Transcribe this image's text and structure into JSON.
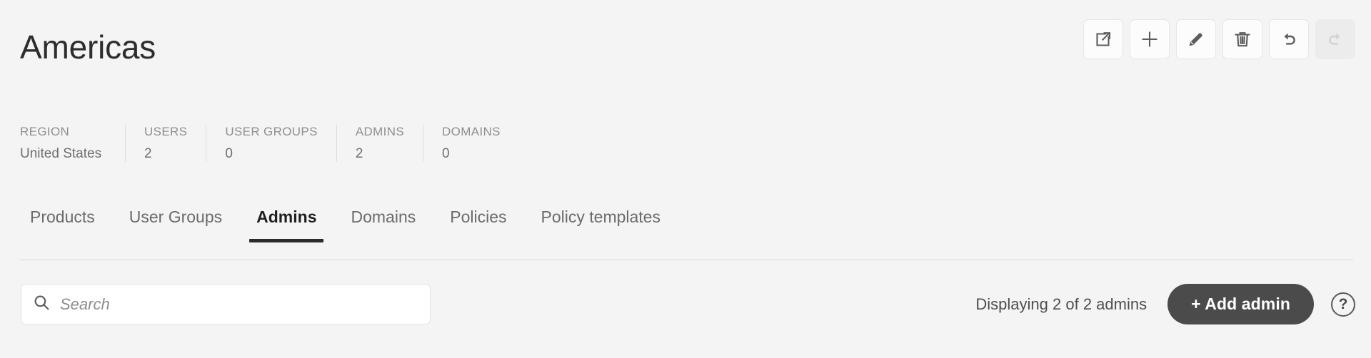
{
  "header": {
    "title": "Americas",
    "toolbar": [
      {
        "name": "export-icon",
        "label": "Export",
        "disabled": false
      },
      {
        "name": "add-icon",
        "label": "Add",
        "disabled": false
      },
      {
        "name": "edit-pencil-icon",
        "label": "Edit",
        "disabled": false
      },
      {
        "name": "delete-trash-icon",
        "label": "Delete",
        "disabled": false
      },
      {
        "name": "undo-icon",
        "label": "Undo",
        "disabled": false
      },
      {
        "name": "redo-icon",
        "label": "Redo",
        "disabled": true
      }
    ]
  },
  "stats": [
    {
      "label": "REGION",
      "value": "United States"
    },
    {
      "label": "USERS",
      "value": "2"
    },
    {
      "label": "USER GROUPS",
      "value": "0"
    },
    {
      "label": "ADMINS",
      "value": "2"
    },
    {
      "label": "DOMAINS",
      "value": "0"
    }
  ],
  "tabs": [
    {
      "label": "Products",
      "active": false
    },
    {
      "label": "User Groups",
      "active": false
    },
    {
      "label": "Admins",
      "active": true
    },
    {
      "label": "Domains",
      "active": false
    },
    {
      "label": "Policies",
      "active": false
    },
    {
      "label": "Policy templates",
      "active": false
    }
  ],
  "controls": {
    "search_placeholder": "Search",
    "search_value": "",
    "search_icon": "magnifier-icon",
    "displaying_text": "Displaying 2 of 2 admins",
    "add_admin_label": "+ Add admin",
    "help_label": "?"
  },
  "colors": {
    "page_background": "#f4f4f4",
    "accent_dark": "#4b4b4b",
    "active_tab_underline": "#2b2b2b",
    "muted_text": "#8f8f8f",
    "divider": "#e7e7e7"
  }
}
